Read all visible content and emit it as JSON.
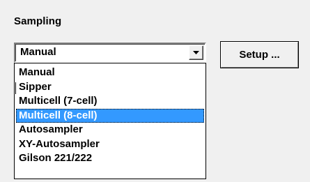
{
  "sampling": {
    "title": "Sampling",
    "selected_value": "Manual",
    "setup_label": "Setup ...",
    "options": [
      "Manual",
      "Sipper",
      "Multicell (7-cell)",
      "Multicell (8-cell)",
      "Autosampler",
      "XY-Autosampler",
      "Gilson 221/222"
    ],
    "highlighted_index": 3,
    "colors": {
      "highlight": "#3399ff",
      "background": "#f0f0f0"
    },
    "icons": {
      "dropdown_arrow": "chevron-down-icon"
    }
  }
}
